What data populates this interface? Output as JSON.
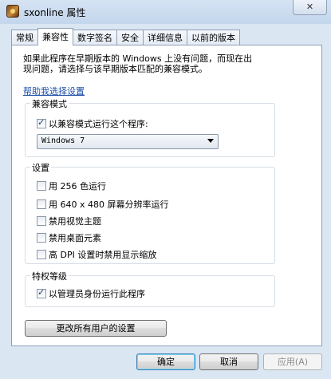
{
  "window": {
    "title": "sxonline 属性",
    "close_glyph": "✕"
  },
  "tabs": [
    {
      "label": "常规"
    },
    {
      "label": "兼容性"
    },
    {
      "label": "数字签名"
    },
    {
      "label": "安全"
    },
    {
      "label": "详细信息"
    },
    {
      "label": "以前的版本"
    }
  ],
  "active_tab": "兼容性",
  "intro": {
    "line1": "如果此程序在早期版本的 Windows 上没有问题，而现在出",
    "line2": "现问题，请选择与该早期版本匹配的兼容模式。"
  },
  "help_link": "帮助我选择设置",
  "compat_mode": {
    "label": "兼容模式",
    "checkbox_label": "以兼容模式运行这个程序:",
    "checked": true,
    "selected_os": "Windows 7"
  },
  "settings": {
    "label": "设置",
    "items": [
      {
        "label": "用 256 色运行",
        "checked": false
      },
      {
        "label": "用 640 x 480 屏幕分辨率运行",
        "checked": false
      },
      {
        "label": "禁用视觉主题",
        "checked": false
      },
      {
        "label": "禁用桌面元素",
        "checked": false
      },
      {
        "label": "高 DPI 设置时禁用显示缩放",
        "checked": false
      }
    ]
  },
  "privilege": {
    "label": "特权等级",
    "checkbox_label": "以管理员身份运行此程序",
    "checked": true
  },
  "change_all_button": "更改所有用户的设置",
  "buttons": {
    "ok": "确定",
    "cancel": "取消",
    "apply": "应用(A)"
  }
}
